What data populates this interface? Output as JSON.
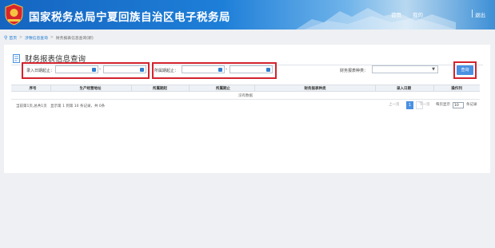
{
  "header": {
    "title": "国家税务总局宁夏回族自治区电子税务局",
    "nav_home": "首页",
    "nav_mine": "我的",
    "nav_logout": "退出",
    "colors": {
      "primary": "#1565c0",
      "accent": "#4a90e2",
      "highlight": "#d3232d"
    }
  },
  "breadcrumb": {
    "icon": "location-pin-icon",
    "home": "首页",
    "level2": "涉税信息查询",
    "level3": "财务报表信息查询(新)"
  },
  "page": {
    "title": "财务报表信息查询"
  },
  "filters": {
    "entry_date_label": "录入日期起止：",
    "entry_date_start": "",
    "entry_date_end": "",
    "period_label": "所属期起止：",
    "period_start": "",
    "period_end": "",
    "report_type_label": "财务报表种类：",
    "report_type_value": "",
    "range_separator": "-",
    "query_button": "查询"
  },
  "table": {
    "columns": [
      "序号",
      "生产经营地址",
      "所属期起",
      "所属期止",
      "财务报表种类",
      "录入日期",
      "操作列"
    ],
    "rows": [],
    "empty_text": "没有数据"
  },
  "pagination": {
    "info": "当前第1页,总共1页　显示第 1 到第 10 条记录，共 0条",
    "prev": "上一页",
    "current_page": "1",
    "next": "下一页",
    "page_size_label": "每页显示",
    "page_size": "10",
    "page_size_suffix": "条记录"
  }
}
